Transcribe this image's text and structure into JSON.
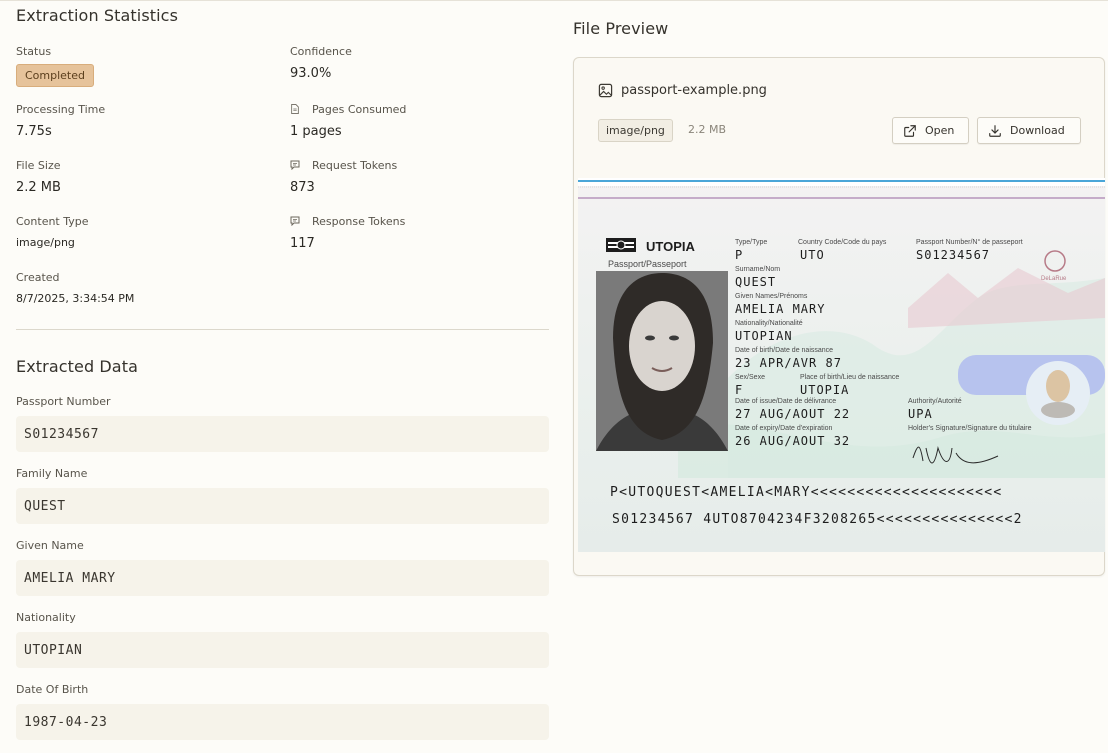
{
  "stats": {
    "title": "Extraction Statistics",
    "status_label": "Status",
    "status_value": "Completed",
    "confidence_label": "Confidence",
    "confidence_value": "93.0%",
    "processing_label": "Processing Time",
    "processing_value": "7.75s",
    "pages_label": "Pages Consumed",
    "pages_value": "1 pages",
    "filesize_label": "File Size",
    "filesize_value": "2.2 MB",
    "request_label": "Request Tokens",
    "request_value": "873",
    "contenttype_label": "Content Type",
    "contenttype_value": "image/png",
    "response_label": "Response Tokens",
    "response_value": "117",
    "created_label": "Created",
    "created_value": "8/7/2025, 3:34:54 PM"
  },
  "extracted": {
    "title": "Extracted Data",
    "fields": [
      {
        "label": "Passport Number",
        "value": "S01234567"
      },
      {
        "label": "Family Name",
        "value": "QUEST"
      },
      {
        "label": "Given Name",
        "value": "AMELIA MARY"
      },
      {
        "label": "Nationality",
        "value": "UTOPIAN"
      },
      {
        "label": "Date Of Birth",
        "value": "1987-04-23"
      }
    ]
  },
  "preview": {
    "title": "File Preview",
    "filename": "passport-example.png",
    "mime": "image/png",
    "size": "2.2 MB",
    "open_label": "Open",
    "download_label": "Download"
  },
  "passport": {
    "country": "UTOPIA",
    "doc_label": "Passport/Passeport",
    "type_label": "Type/Type",
    "type_value": "P",
    "code_label": "Country Code/Code du pays",
    "code_value": "UTO",
    "number_label": "Passport Number/N° de passeport",
    "number_value": "S01234567",
    "surname_label": "Surname/Nom",
    "surname_value": "QUEST",
    "given_label": "Given Names/Prénoms",
    "given_value": "AMELIA MARY",
    "nationality_label": "Nationality/Nationalité",
    "nationality_value": "UTOPIAN",
    "dob_label": "Date of birth/Date de naissance",
    "dob_value": "23 APR/AVR 87",
    "sex_label": "Sex/Sexe",
    "sex_value": "F",
    "pob_label": "Place of birth/Lieu de naissance",
    "pob_value": "UTOPIA",
    "issue_label": "Date of issue/Date de délivrance",
    "issue_value": "27 AUG/AOUT 22",
    "authority_label": "Authority/Autorité",
    "authority_value": "UPA",
    "expiry_label": "Date of expiry/Date d'expiration",
    "expiry_value": "26 AUG/AOUT 32",
    "signature_label": "Holder's Signature/Signature du titulaire",
    "signature_value": "A M Quest",
    "maker": "DeLaRue",
    "mrz1": "P<UTOQUEST<AMELIA<MARY<<<<<<<<<<<<<<<<<<<<<",
    "mrz2": "S01234567 4UTO8704234F3208265<<<<<<<<<<<<<<<2"
  }
}
